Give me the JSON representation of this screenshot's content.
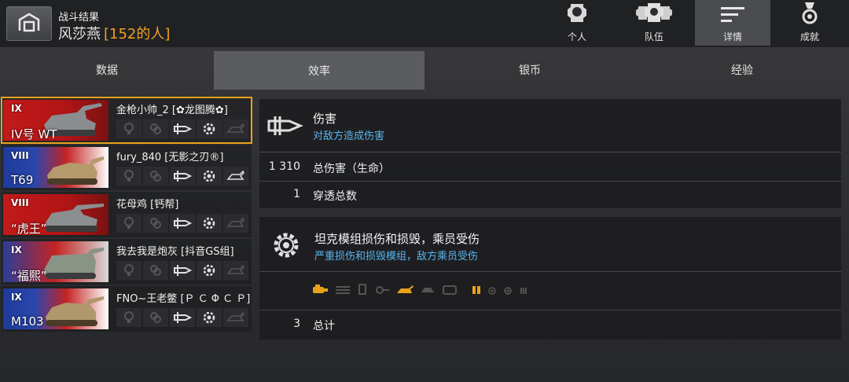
{
  "header": {
    "title": "战斗结果",
    "player_name": "风莎燕",
    "player_clan": "[152的人]",
    "tabs": [
      {
        "label": "个人",
        "icon": "player-icon"
      },
      {
        "label": "队伍",
        "icon": "team-icon"
      },
      {
        "label": "详情",
        "icon": "details-icon"
      },
      {
        "label": "成就",
        "icon": "medal-icon"
      }
    ],
    "active_tab": "详情"
  },
  "subtabs": [
    "数据",
    "效率",
    "银币",
    "经验"
  ],
  "active_subtab": "效率",
  "players": [
    {
      "name": "金枪小帅_2 [✿龙图腾✿]",
      "tier": "IX",
      "tank": "IV号 WT",
      "nation": "de"
    },
    {
      "name": "fury_840 [无影之刃®]",
      "tier": "VIII",
      "tank": "T69",
      "nation": "us"
    },
    {
      "name": "花母鸡 [钙帮]",
      "tier": "VIII",
      "tank": "“虎王”",
      "nation": "de"
    },
    {
      "name": "我去我是炮灰 [抖音GS组]",
      "tier": "IX",
      "tank": "“福熙”",
      "nation": "us2"
    },
    {
      "name": "FNO~王老鳖 [Ｐ Ｃ Φ Ｃ Ｐ]",
      "tier": "IX",
      "tank": "M103",
      "nation": "us"
    }
  ],
  "damage_panel": {
    "title": "伤害",
    "subtitle": "对敌方造成伤害",
    "rows": [
      {
        "value": "1 310",
        "label": "总伤害（生命）"
      },
      {
        "value": "1",
        "label": "穿透总数"
      }
    ]
  },
  "module_panel": {
    "title": "坦克模组损伤和损毁，乘员受伤",
    "subtitle": "严重损伤和损毁模组，敌方乘员受伤",
    "total_value": "3",
    "total_label": "总计"
  },
  "colors": {
    "accent": "#e8a21a",
    "subtitle": "#58b6f0",
    "clan": "#f0a020"
  }
}
